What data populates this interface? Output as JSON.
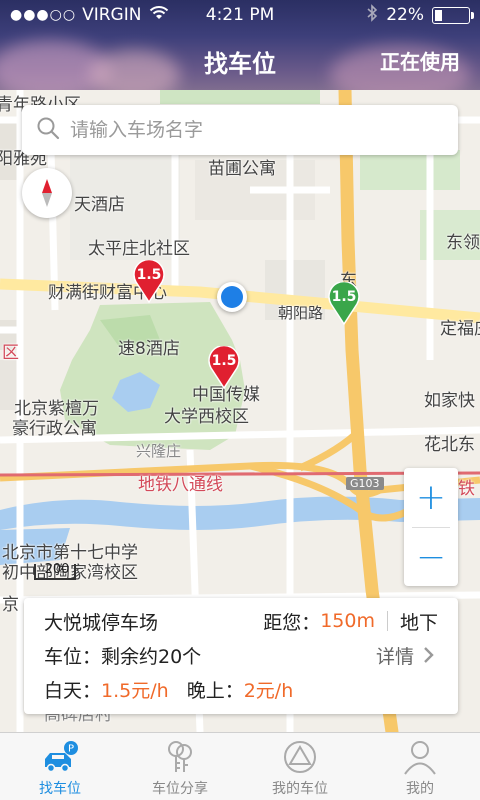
{
  "status_bar": {
    "signal": "●●●○○",
    "carrier": "VIRGIN",
    "time": "4:21 PM",
    "battery": "22%",
    "battery_level": 0.22
  },
  "header": {
    "title": "找车位",
    "right_action": "正在使用"
  },
  "search": {
    "placeholder": "请输入车场名字"
  },
  "map": {
    "labels": {
      "l1": "青年路小区",
      "l2": "阳雅苑",
      "l3": "苗圃公寓",
      "l4": "天酒店",
      "l5": "东领",
      "l6": "太平庄北社区",
      "l7": "财满街财富中心",
      "l8": "东",
      "l9": "朝阳路",
      "l10": "定福庄",
      "l11": "区",
      "l12": "速8酒店",
      "l13": "中国传媒",
      "l14": "大学西校区",
      "l15": "如家快",
      "l16": "北京紫檀万",
      "l17": "豪行政公寓",
      "l18": "兴隆庄",
      "l19": "花北东",
      "l20": "地铁八通线",
      "l21": "G103",
      "l22": "铁",
      "l23": "北京市第十七中学",
      "l24": "初中部陶家湾校区",
      "l25": "京",
      "l26": "高碑店村"
    },
    "markers": [
      "1.5",
      "1.5",
      "1.5"
    ],
    "scale": "200",
    "zoom_in": "+",
    "zoom_out": "−"
  },
  "parking_card": {
    "name": "大悦城停车场",
    "distance_label": "距您：",
    "distance": "150m",
    "level": "地下",
    "spaces": "车位：剩余约20个",
    "details": "详情",
    "day_label": "白天：",
    "day_price": "1.5元/h",
    "night_label": "晚上：",
    "night_price": "2元/h"
  },
  "tabs": [
    {
      "label": "找车位",
      "icon": "car-parking-icon",
      "active": true
    },
    {
      "label": "车位分享",
      "icon": "share-keys-icon",
      "active": false
    },
    {
      "label": "我的车位",
      "icon": "my-spot-icon",
      "active": false
    },
    {
      "label": "我的",
      "icon": "profile-icon",
      "active": false
    }
  ],
  "colors": {
    "accent": "#1e8ee0",
    "price": "#f06a2a",
    "marker_red": "#e02030",
    "marker_green": "#3aa64a"
  }
}
